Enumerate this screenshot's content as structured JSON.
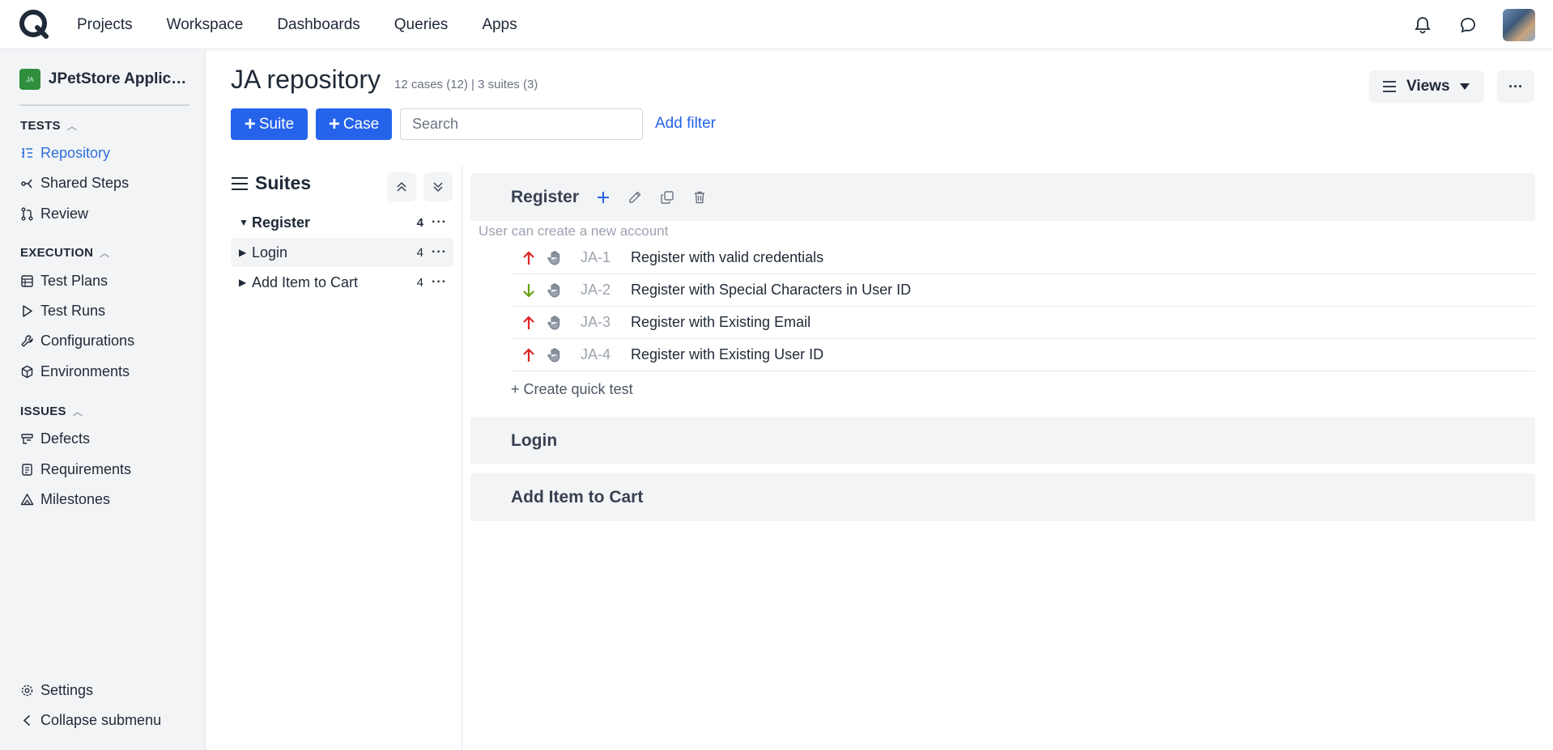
{
  "topbar": {
    "nav": [
      "Projects",
      "Workspace",
      "Dashboards",
      "Queries",
      "Apps"
    ]
  },
  "sidebar": {
    "project_badge": "JA",
    "project_name": "JPetStore Applicat...",
    "sections": {
      "tests": "TESTS",
      "execution": "EXECUTION",
      "issues": "ISSUES"
    },
    "items": {
      "repository": "Repository",
      "shared_steps": "Shared Steps",
      "review": "Review",
      "test_plans": "Test Plans",
      "test_runs": "Test Runs",
      "configurations": "Configurations",
      "environments": "Environments",
      "defects": "Defects",
      "requirements": "Requirements",
      "milestones": "Milestones",
      "settings": "Settings",
      "collapse": "Collapse submenu"
    }
  },
  "header": {
    "title": "JA repository",
    "meta": "12 cases (12) | 3 suites (3)",
    "views_label": "Views",
    "more_label": "···"
  },
  "toolbar": {
    "suite_label": "Suite",
    "case_label": "Case",
    "search_placeholder": "Search",
    "add_filter": "Add filter"
  },
  "suites_panel": {
    "title": "Suites",
    "items": [
      {
        "name": "Register",
        "count": "4",
        "caret": "▼"
      },
      {
        "name": "Login",
        "count": "4",
        "caret": "▶"
      },
      {
        "name": "Add Item to Cart",
        "count": "4",
        "caret": "▶"
      }
    ]
  },
  "content": {
    "suites": [
      {
        "name": "Register",
        "description": "User can create a new account"
      },
      {
        "name": "Login"
      },
      {
        "name": "Add Item to Cart"
      }
    ],
    "cases": [
      {
        "id": "JA-1",
        "title": "Register with valid credentials",
        "priority": "high"
      },
      {
        "id": "JA-2",
        "title": "Register with Special Characters in User ID",
        "priority": "low"
      },
      {
        "id": "JA-3",
        "title": "Register with Existing Email",
        "priority": "high"
      },
      {
        "id": "JA-4",
        "title": "Register with Existing User ID",
        "priority": "high"
      }
    ],
    "quick_test": "+ Create quick test"
  },
  "colors": {
    "accent": "#2563eb",
    "priority_high": "#dc2626",
    "priority_low": "#65a30d"
  }
}
